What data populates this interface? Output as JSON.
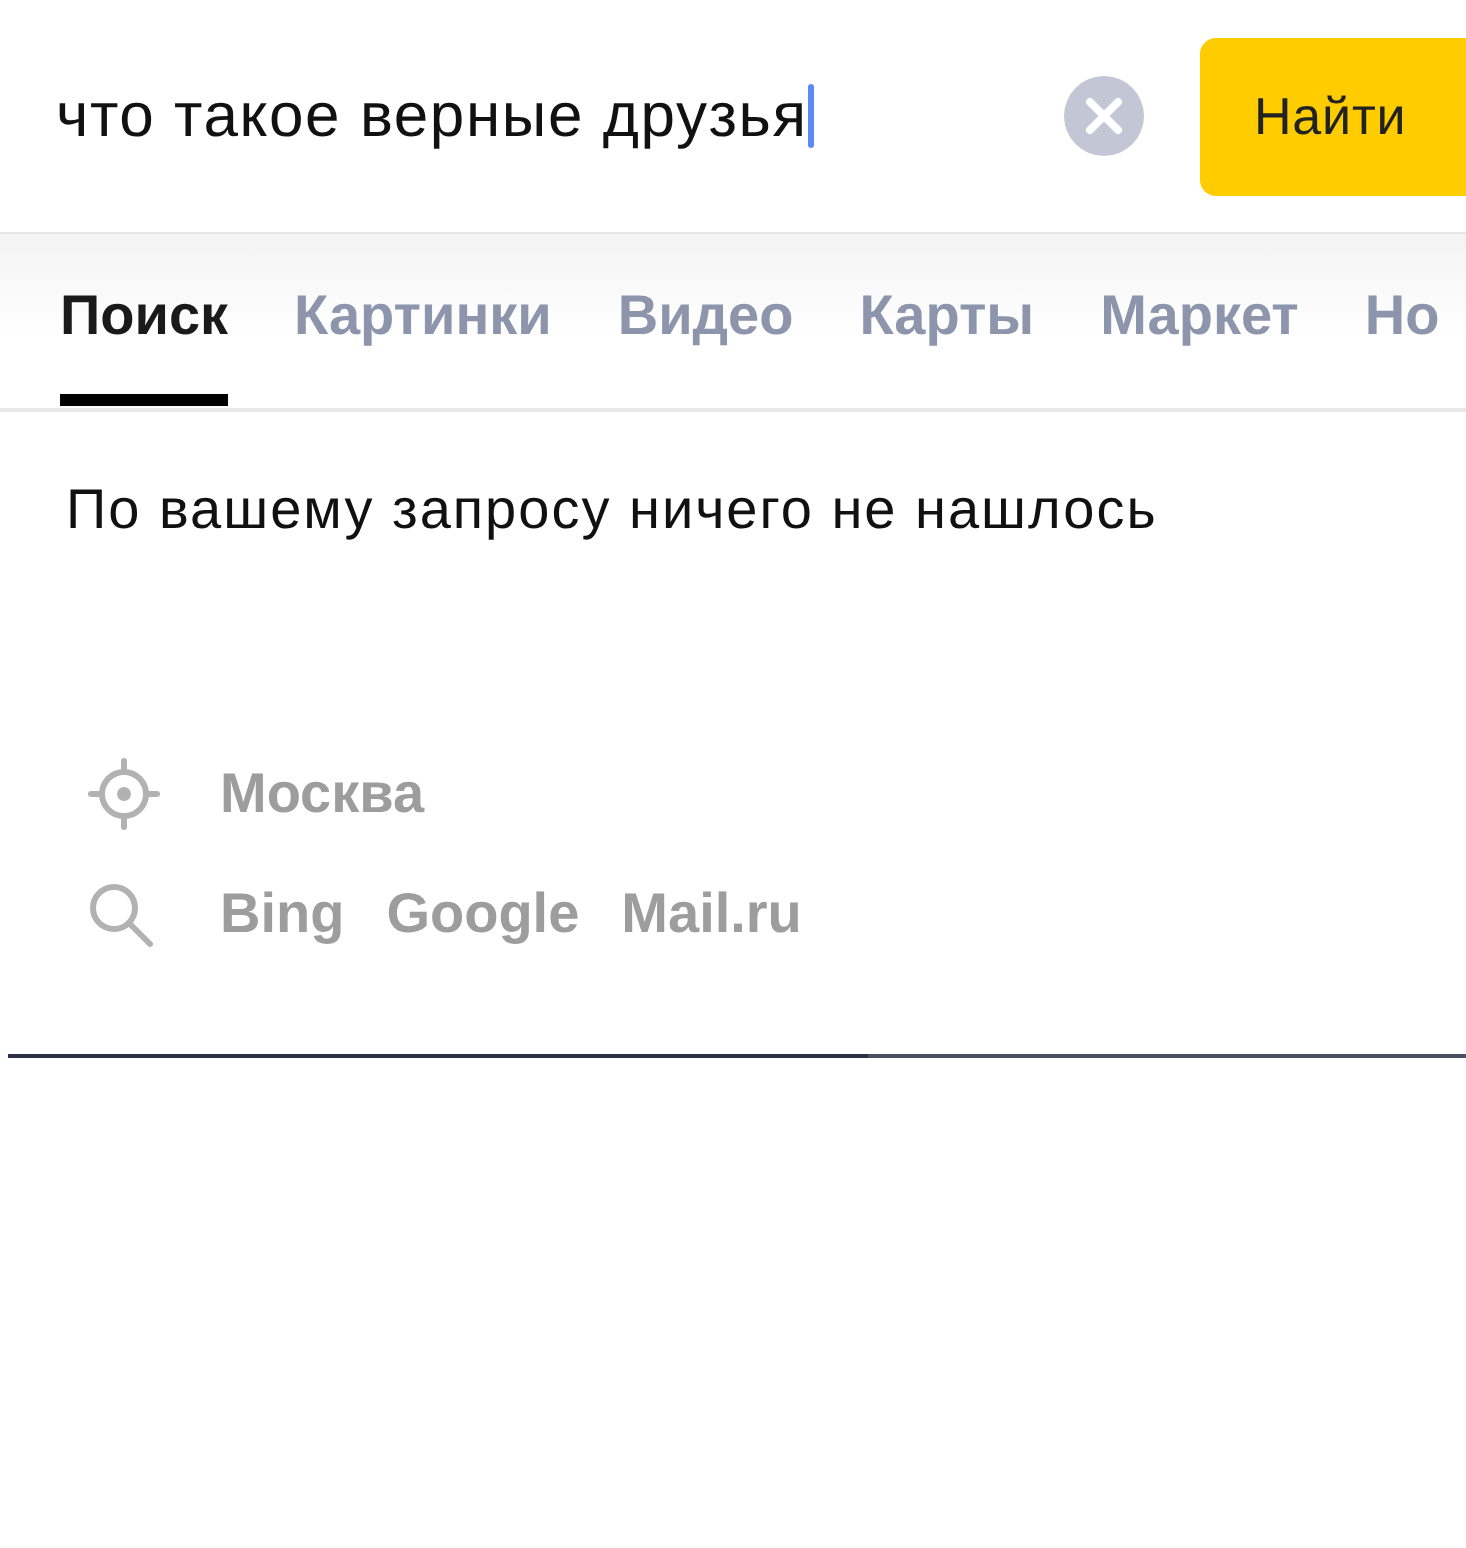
{
  "search": {
    "value": "что такое верные друзья",
    "focused": true,
    "submit_label": "Найти"
  },
  "tabs": [
    {
      "label": "Поиск",
      "selected": true
    },
    {
      "label": "Картинки",
      "selected": false
    },
    {
      "label": "Видео",
      "selected": false
    },
    {
      "label": "Карты",
      "selected": false
    },
    {
      "label": "Маркет",
      "selected": false
    },
    {
      "label": "Но",
      "selected": false
    }
  ],
  "message": "По вашему запросу ничего не нашлось",
  "region": {
    "label": "Москва"
  },
  "other_engines": [
    "Bing",
    "Google",
    "Mail.ru"
  ]
}
